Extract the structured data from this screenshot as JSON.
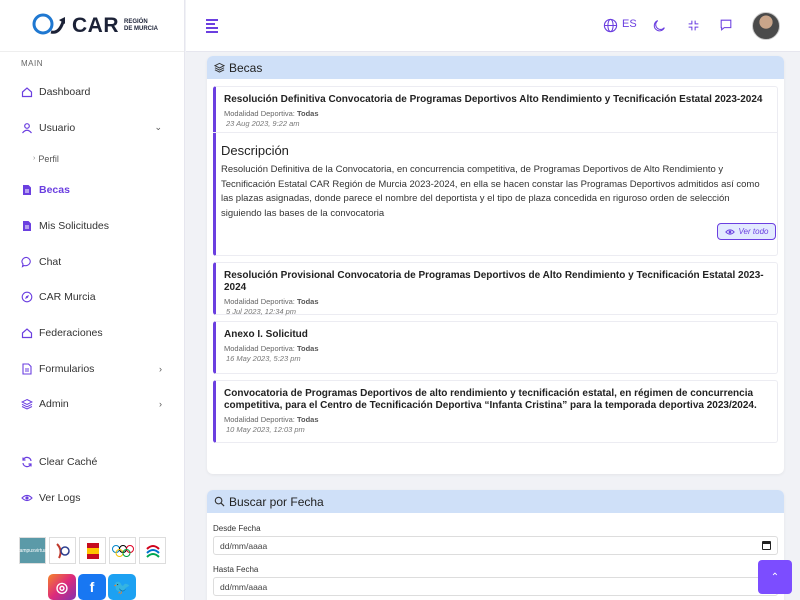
{
  "brand": {
    "name": "CAR",
    "sub_line1": "REGIÓN",
    "sub_line2": "DE MURCIA"
  },
  "sidebar": {
    "section": "MAIN",
    "items": [
      {
        "label": "Dashboard",
        "icon": "home-icon"
      },
      {
        "label": "Usuario",
        "icon": "user-icon"
      },
      {
        "label": "Becas",
        "icon": "document-icon"
      },
      {
        "label": "Mis Solicitudes",
        "icon": "file-icon"
      },
      {
        "label": "Chat",
        "icon": "chat-icon"
      },
      {
        "label": "CAR Murcia",
        "icon": "compass-icon"
      },
      {
        "label": "Federaciones",
        "icon": "home-icon"
      },
      {
        "label": "Formularios",
        "icon": "form-icon"
      },
      {
        "label": "Admin",
        "icon": "layers-icon"
      },
      {
        "label": "Clear Caché",
        "icon": "refresh-icon"
      },
      {
        "label": "Ver Logs",
        "icon": "eye-icon"
      }
    ],
    "sub_item": "Perfil",
    "partners": [
      "campus virtual",
      "",
      "",
      "",
      ""
    ],
    "campus_line1": "campus",
    "campus_line2": "virtual"
  },
  "topbar": {
    "lang": "ES"
  },
  "becas": {
    "title": "Becas",
    "entries": [
      {
        "title": "Resolución Definitiva Convocatoria de Programas Deportivos Alto Rendimiento y Tecnificación Estatal 2023-2024",
        "meta_label": "Modalidad Deportiva:",
        "meta_value": "Todas",
        "date": "23 Aug 2023, 9:22 am"
      },
      {
        "title": "Resolución Provisional Convocatoria de Programas Deportivos de Alto Rendimiento y Tecnificación Estatal 2023-2024",
        "meta_label": "Modalidad Deportiva:",
        "meta_value": "Todas",
        "date": "5 Jul 2023, 12:34 pm"
      },
      {
        "title": "Anexo I. Solicitud",
        "meta_label": "Modalidad Deportiva:",
        "meta_value": "Todas",
        "date": "16 May 2023, 5:23 pm"
      },
      {
        "title": "Convocatoria de Programas Deportivos de alto rendimiento y tecnificación estatal, en régimen de concurrencia competitiva, para el Centro de Tecnificación Deportiva “Infanta Cristina” para la temporada deportiva 2023/2024.",
        "meta_label": "Modalidad Deportiva:",
        "meta_value": "Todas",
        "date": "10 May 2023, 12:03 pm"
      }
    ],
    "description_title": "Descripción",
    "description_text": "Resolución Definitiva de la Convocatoria, en concurrencia competitiva, de Programas Deportivos de Alto Rendimiento y Tecnificación Estatal CAR Región de Murcia 2023-2024, en ella se hacen constar las Programas Deportivos admitidos así como las plazas asignadas, donde parece el nombre del deportista y el tipo de plaza concedida en riguroso orden de selección siguiendo las bases de la convocatoria",
    "ver_todo": "Ver todo"
  },
  "search": {
    "title": "Buscar por Fecha",
    "from_label": "Desde Fecha",
    "from_placeholder": "dd/mm/aaaa",
    "to_label": "Hasta Fecha",
    "to_placeholder": "dd/mm/aaaa"
  },
  "colors": {
    "accent": "#6b3fe0",
    "header_bg": "#cfe0f8"
  }
}
